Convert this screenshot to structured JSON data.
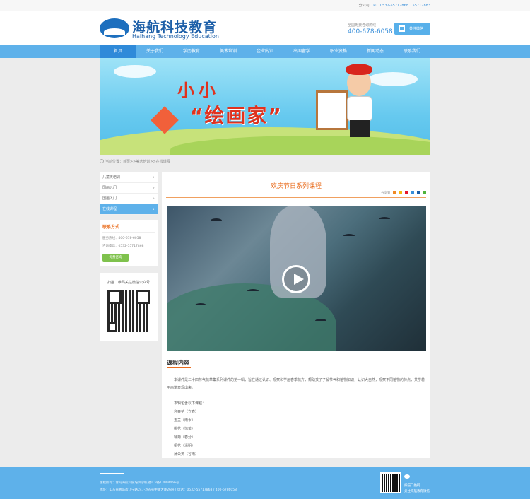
{
  "topbar": {
    "links": [
      "分公司",
      "0532-55717868",
      "55717883"
    ]
  },
  "header": {
    "logo_cn": "海航科技教育",
    "logo_en": "Haihang Technology Education",
    "hotline_label": "全国免费咨询热线",
    "hotline_number": "400-678-6058",
    "follow_label": "关注微信"
  },
  "nav": {
    "items": [
      "首页",
      "关于我们",
      "学历教育",
      "美术培训",
      "企业内训",
      "出国留学",
      "职业资格",
      "新闻动态",
      "联系我们"
    ],
    "active_index": 0
  },
  "banner": {
    "line1": "小小",
    "line2": "“绘画家”"
  },
  "breadcrumb": "当前位置：首页>>美术培训>>在线课程",
  "sidebar": {
    "items": [
      "儿童美培训",
      "国画入门",
      "国画入门",
      "在线课程"
    ],
    "active_index": 3,
    "contact_title": "联系方式",
    "contact_lines": [
      "服务热线：400-678-6058",
      "咨询电话：0532-55717868"
    ],
    "contact_button": "免费咨询",
    "qr_title": "扫描二维码关注微信公众号"
  },
  "content": {
    "title": "欢庆节日系列课程",
    "share_label": "分享到",
    "section_title": "课程内容",
    "paragraph": "本课件是二十四节气花草集系列课件的第一辑，旨在通过认识、观察和学画春季花卉，帮助孩子了解节气和植物知识，认识大自然，观察不同植物的特点，共学着用画笔表现出来。",
    "list_head": "本辑包含以下课程：",
    "list_items": [
      "迎春花（立春）",
      "玉兰（雨水）",
      "桃花（惊蛰）",
      "辅菊（春分）",
      "桐花（清明）",
      "蒲公英（谷雨）"
    ]
  },
  "footer": {
    "line1": "版权所有：青岛海航科技培训学校  备ICP备13004466号",
    "line2": "地址：山东省青岛市辽宁路247-269号中联大厦26层  |  电话：0532-55717868 / 400-6786058",
    "qr_line1": "扫描二维码",
    "qr_line2": "关注海航教育微信"
  },
  "colors": {
    "nav": "#5eb1ea",
    "nav_active": "#2f8ad9",
    "accent_orange": "#e96b1b",
    "footer": "#5eb1ea"
  }
}
